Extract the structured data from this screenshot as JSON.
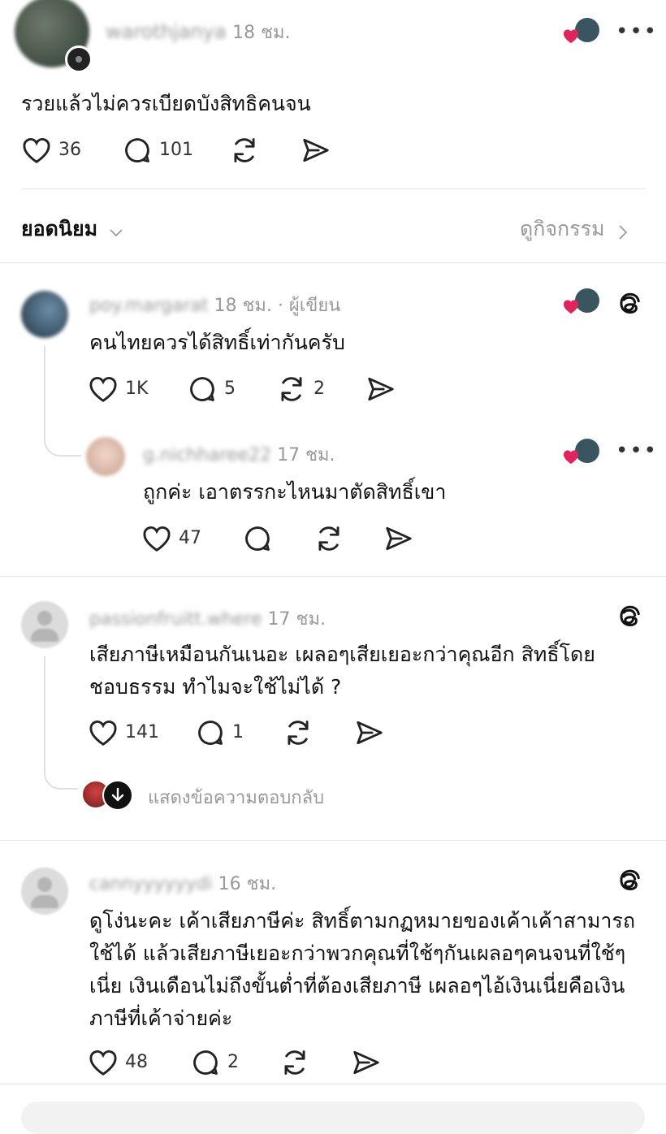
{
  "top_post": {
    "username": "warothjanya",
    "time": "18 ชม.",
    "text": "รวยแล้วไม่ควรเบียดบังสิทธิคนจน",
    "likes": "36",
    "replies": "101",
    "more_icon": "more-horizontal-icon"
  },
  "sort_bar": {
    "label": "ยอดนิยม",
    "activity_link": "ดูกิจกรรม"
  },
  "replies": [
    {
      "username": "poy.margarat",
      "time": "18 ชม. · ผู้เขียน",
      "text": "คนไทยควรได้สิทธิ์เท่ากันครับ",
      "likes": "1K",
      "replies": "5",
      "reposts": "2"
    },
    {
      "username": "g.nichharee22",
      "time": "17 ชม.",
      "text": "ถูกค่ะ  เอาตรรกะไหนมาตัดสิทธิ์เขา",
      "likes": "47"
    },
    {
      "username": "passionfruitt.where",
      "time": "17 ชม.",
      "text_line1": "เสียภาษีเหมือนกันเนอะ เผลอๆเสียเยอะกว่าคุณอีก สิทธิ์โดย",
      "text_line2": "ชอบธรรม ทำไมจะใช้ไม่ได้ ?",
      "likes": "141",
      "replies": "1",
      "show_replies": "แสดงข้อความตอบกลับ"
    },
    {
      "username": "cannyyyyyydi",
      "time": "16 ชม.",
      "text_line1": "ดูโง่นะคะ เค้าเสียภาษีค่ะ สิทธิ์ตามกฏหมายของเค้าเค้าสามารถ",
      "text_line2": "ใช้ได้ แล้วเสียภาษีเยอะกว่าพวกคุณที่ใช้ๆกันเผลอๆคนจนที่ใช้ๆ",
      "text_line3": "เนี่ย เงินเดือนไม่ถึงขั้นต่ำที่ต้องเสียภาษี เผลอๆไอ้เงินเนี่ยคือเงิน",
      "text_line4": "ภาษีที่เค้าจ่ายค่ะ",
      "likes": "48",
      "replies": "2"
    }
  ],
  "more_label": "•••",
  "colors": {
    "heart": "#e0245e",
    "separator": "#e3e3e3",
    "muted": "#999999"
  }
}
